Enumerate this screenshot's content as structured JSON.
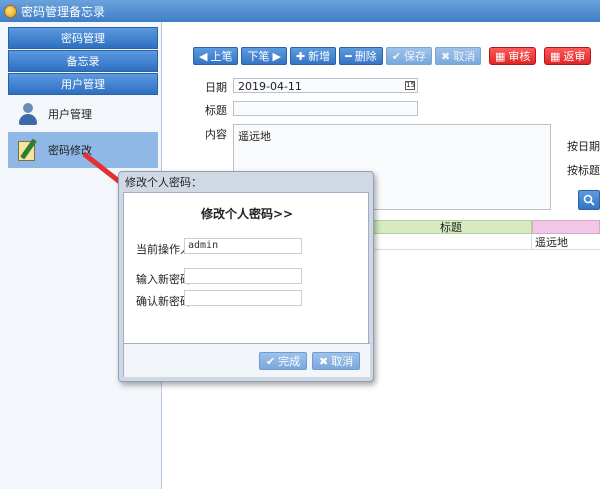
{
  "window": {
    "title": "密码管理备忘录"
  },
  "sidebar": {
    "headers": [
      "密码管理",
      "备忘录",
      "用户管理"
    ],
    "items": [
      {
        "label": "用户管理",
        "icon": "user-icon"
      },
      {
        "label": "密码修改",
        "icon": "notepad-pen-icon"
      }
    ]
  },
  "toolbar": {
    "prev": "上笔",
    "next": "下笔",
    "add": "新增",
    "delete": "删除",
    "save": "保存",
    "cancel": "取消",
    "review": "审核",
    "back": "返审"
  },
  "form": {
    "date_label": "日期",
    "date_value": "2019-04-11",
    "title_label": "标题",
    "title_value": "",
    "content_label": "内容",
    "content_value": "遥远地"
  },
  "search": {
    "by_date": "按日期查",
    "by_title": "按标题查"
  },
  "grid": {
    "header_title": "标题",
    "row_title": "遥远地"
  },
  "dialog": {
    "title": "修改个人密码：",
    "heading": "修改个人密码>>",
    "operator_label": "当前操作人",
    "operator_value": "admin",
    "new_pwd_label": "输入新密码",
    "new_pwd_value": "",
    "confirm_pwd_label": "确认新密码",
    "confirm_pwd_value": "",
    "ok": "完成",
    "cancel": "取消"
  },
  "colors": {
    "accent": "#3474c4",
    "danger": "#e02525",
    "arrow": "#e53030",
    "grid_green": "#d6ecc0",
    "grid_pink": "#f1c7e6"
  }
}
